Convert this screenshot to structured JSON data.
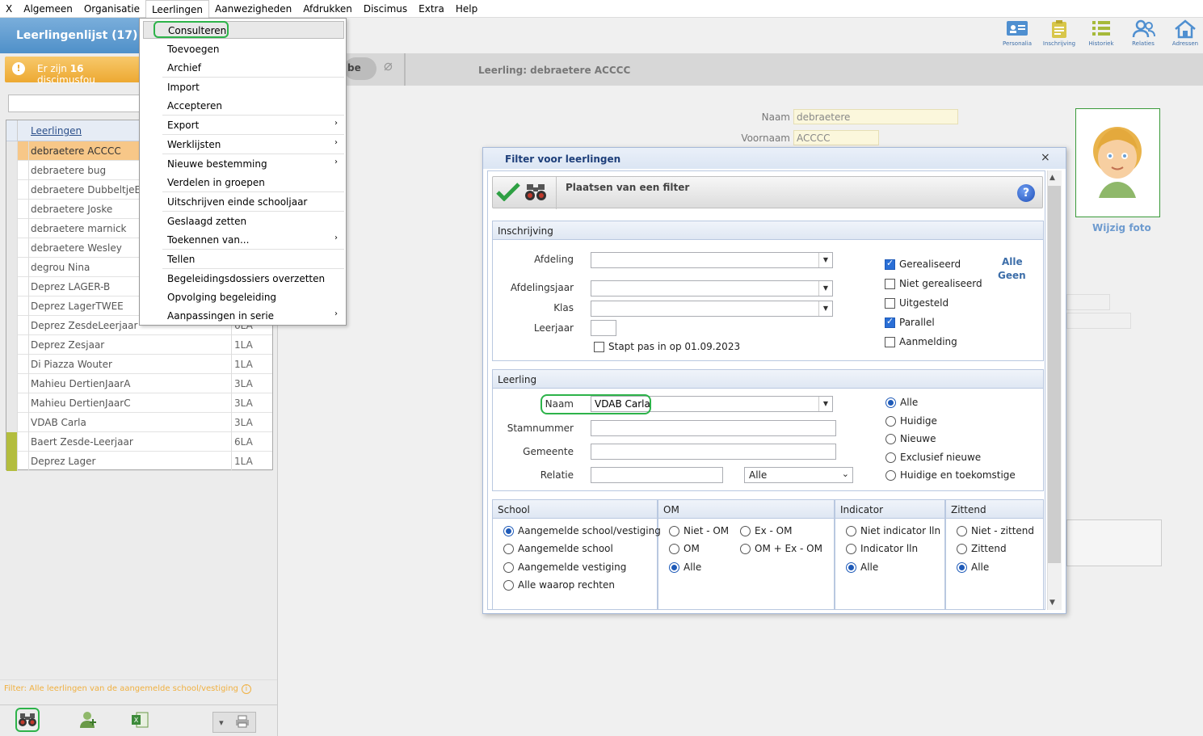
{
  "menubar": {
    "items": [
      "X",
      "Algemeen",
      "Organisatie",
      "Leerlingen",
      "Aanwezigheden",
      "Afdrukken",
      "Discimus",
      "Extra",
      "Help"
    ]
  },
  "left_panel": {
    "title": "Leerlingenlijst (17)",
    "alert": {
      "prefix": "Er zijn",
      "count": "16",
      "rest": "discimusfou"
    },
    "column_header": "Leerlingen",
    "rows": [
      {
        "name": "debraetere ACCCC",
        "class": ""
      },
      {
        "name": "debraetere bug",
        "class": ""
      },
      {
        "name": "debraetere DubbeltjeEEN",
        "class": ""
      },
      {
        "name": "debraetere Joske",
        "class": ""
      },
      {
        "name": "debraetere marnick",
        "class": ""
      },
      {
        "name": "debraetere Wesley",
        "class": ""
      },
      {
        "name": "degrou Nina",
        "class": ""
      },
      {
        "name": "Deprez LAGER-B",
        "class": ""
      },
      {
        "name": "Deprez LagerTWEE",
        "class": ""
      },
      {
        "name": "Deprez ZesdeLeerjaar",
        "class": "6LA"
      },
      {
        "name": "Deprez Zesjaar",
        "class": "1LA"
      },
      {
        "name": "Di Piazza Wouter",
        "class": "1LA"
      },
      {
        "name": "Mahieu DertienJaarA",
        "class": "3LA"
      },
      {
        "name": "Mahieu DertienJaarC",
        "class": "3LA"
      },
      {
        "name": "VDAB Carla",
        "class": "3LA"
      },
      {
        "name": "Baert Zesde-Leerjaar",
        "class": "6LA"
      },
      {
        "name": "Deprez Lager",
        "class": "1LA"
      }
    ],
    "filter_text": "Filter: Alle leerlingen van de aangemelde school/vestiging",
    "filter_info_icon": "i"
  },
  "top_toolbar": {
    "items": [
      {
        "label": "Personalia",
        "icon": "id-card-icon"
      },
      {
        "label": "Inschrijving",
        "icon": "clipboard-icon"
      },
      {
        "label": "Historiek",
        "icon": "list-icon"
      },
      {
        "label": "Relaties",
        "icon": "people-icon"
      },
      {
        "label": "Adressen",
        "icon": "home-icon"
      }
    ]
  },
  "detail": {
    "toggle_label": "be",
    "title": "Leerling: debraetere ACCCC",
    "naam_label": "Naam",
    "naam_value": "debraetere",
    "voornaam_label": "Voornaam",
    "voornaam_value": "ACCCC",
    "photo_link": "Wijzig foto"
  },
  "leerlingen_menu": {
    "items": [
      {
        "label": "Consulteren",
        "submenu": false
      },
      {
        "label": "Toevoegen",
        "submenu": false
      },
      {
        "label": "Archief",
        "submenu": false
      },
      {
        "label": "Import",
        "submenu": false
      },
      {
        "label": "Accepteren",
        "submenu": false
      },
      {
        "label": "Export",
        "submenu": true
      },
      {
        "label": "Werklijsten",
        "submenu": true
      },
      {
        "label": "Nieuwe bestemming",
        "submenu": true
      },
      {
        "label": "Verdelen in groepen",
        "submenu": false
      },
      {
        "label": "Uitschrijven einde schooljaar",
        "submenu": false
      },
      {
        "label": "Geslaagd zetten",
        "submenu": false
      },
      {
        "label": "Toekennen van...",
        "submenu": true
      },
      {
        "label": "Tellen",
        "submenu": false
      },
      {
        "label": "Begeleidingsdossiers overzetten",
        "submenu": false
      },
      {
        "label": "Opvolging begeleiding",
        "submenu": false
      },
      {
        "label": "Aanpassingen in serie",
        "submenu": true
      }
    ],
    "submenu_arrow": "›"
  },
  "dialog": {
    "title": "Filter voor leerlingen",
    "close": "×",
    "heading": "Plaatsen van een filter",
    "help": "?",
    "inschrijving": {
      "header": "Inschrijving",
      "afdeling_label": "Afdeling",
      "afdelingsjaar_label": "Afdelingsjaar",
      "klas_label": "Klas",
      "leerjaar_label": "Leerjaar",
      "stapt_label": "Stapt pas in op 01.09.2023",
      "checks": [
        {
          "label": "Gerealiseerd",
          "checked": true
        },
        {
          "label": "Niet gerealiseerd",
          "checked": false
        },
        {
          "label": "Uitgesteld",
          "checked": false
        },
        {
          "label": "Parallel",
          "checked": true
        },
        {
          "label": "Aanmelding",
          "checked": false
        }
      ],
      "link_all": "Alle",
      "link_none": "Geen"
    },
    "leerling": {
      "header": "Leerling",
      "naam_label": "Naam",
      "naam_value": "VDAB Carla",
      "stamnummer_label": "Stamnummer",
      "gemeente_label": "Gemeente",
      "relatie_label": "Relatie",
      "relatie_select": "Alle",
      "radios": [
        {
          "label": "Alle",
          "checked": true
        },
        {
          "label": "Huidige",
          "checked": false
        },
        {
          "label": "Nieuwe",
          "checked": false
        },
        {
          "label": "Exclusief nieuwe",
          "checked": false
        },
        {
          "label": "Huidige en toekomstige",
          "checked": false
        }
      ]
    },
    "school": {
      "header": "School",
      "radios": [
        {
          "label": "Aangemelde school/vestiging",
          "checked": true
        },
        {
          "label": "Aangemelde school",
          "checked": false
        },
        {
          "label": "Aangemelde vestiging",
          "checked": false
        },
        {
          "label": "Alle waarop rechten",
          "checked": false
        }
      ]
    },
    "om": {
      "header": "OM",
      "radios": [
        {
          "label": "Niet - OM",
          "checked": false
        },
        {
          "label": "Ex - OM",
          "checked": false
        },
        {
          "label": "OM",
          "checked": false
        },
        {
          "label": "OM + Ex - OM",
          "checked": false
        },
        {
          "label": "Alle",
          "checked": true
        }
      ]
    },
    "indicator": {
      "header": "Indicator",
      "radios": [
        {
          "label": "Niet indicator lln",
          "checked": false
        },
        {
          "label": "Indicator lln",
          "checked": false
        },
        {
          "label": "Alle",
          "checked": true
        }
      ]
    },
    "zittend": {
      "header": "Zittend",
      "radios": [
        {
          "label": "Niet - zittend",
          "checked": false
        },
        {
          "label": "Zittend",
          "checked": false
        },
        {
          "label": "Alle",
          "checked": true
        }
      ]
    }
  },
  "colors": {
    "accent_blue": "#5b9bd5",
    "alert_orange": "#eda932",
    "highlight_green": "#2db34a",
    "selected_row": "#f7c788"
  }
}
